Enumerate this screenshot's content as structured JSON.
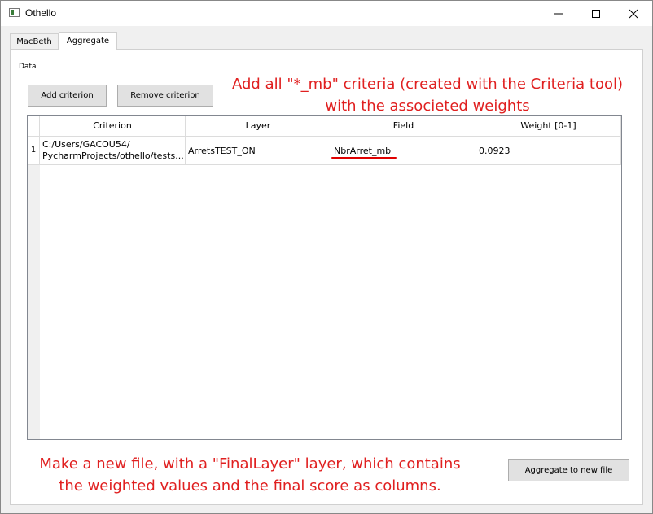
{
  "window": {
    "title": "Othello",
    "icon": "app-window-icon",
    "controls": [
      "minimize-icon",
      "maximize-icon",
      "close-icon"
    ]
  },
  "tabs": [
    {
      "label": "MacBeth",
      "active": false
    },
    {
      "label": "Aggregate",
      "active": true
    }
  ],
  "panel": {
    "section_label": "Data",
    "buttons": {
      "add": "Add criterion",
      "remove": "Remove criterion",
      "aggregate": "Aggregate to new file"
    }
  },
  "table": {
    "headers": [
      "Criterion",
      "Layer",
      "Field",
      "Weight [0-1]"
    ],
    "rows": [
      {
        "index": "1",
        "criterion_line1": "C:/Users/GACOU54/",
        "criterion_line2": "PycharmProjects/othello/tests...",
        "layer": "ArretsTEST_ON",
        "field": "NbrArret_mb",
        "weight": "0.0923"
      }
    ]
  },
  "annotations": {
    "top_line1": "Add all \"*_mb\" criteria (created with the Criteria tool)",
    "top_line2": "with the associeted weights",
    "bottom_line1": "Make a new file, with a \"FinalLayer\" layer, which contains",
    "bottom_line2": "the weighted values and the final score as columns."
  },
  "colors": {
    "annotation": "#e02020",
    "button_bg": "#e1e1e1"
  }
}
